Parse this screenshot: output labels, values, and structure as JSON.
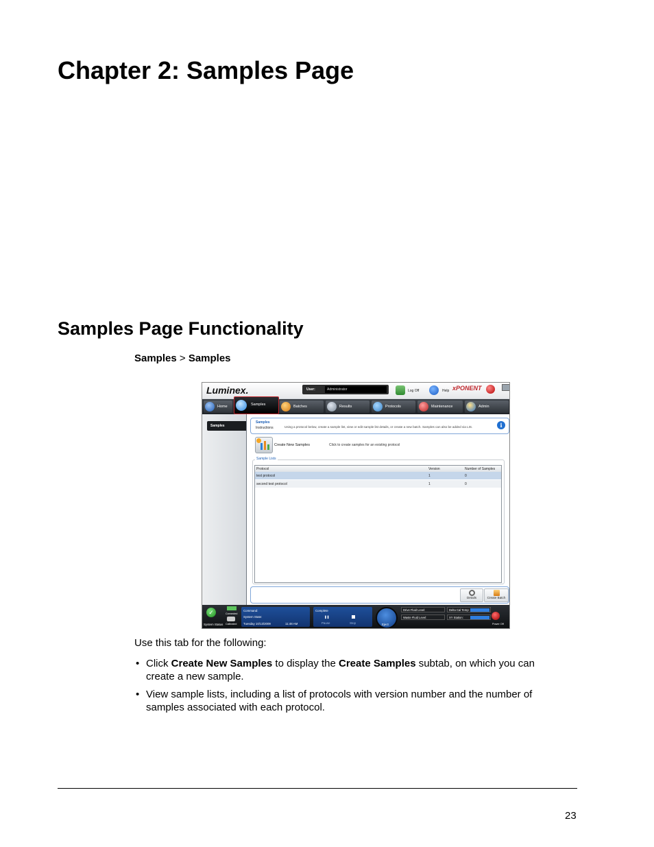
{
  "document": {
    "chapter_title": "Chapter 2: Samples Page",
    "section_title": "Samples Page Functionality",
    "breadcrumb": {
      "part1": "Samples",
      "sep": ">",
      "part2": "Samples"
    },
    "intro": "Use this tab for the following:",
    "bullets": [
      {
        "pre": "Click ",
        "b1": "Create New Samples",
        "mid": " to display the ",
        "b2": "Create Samples",
        "post": " subtab, on which you can create a new sample."
      },
      {
        "text": "View sample lists, including a list of protocols with version number and the number of samples associated with each protocol."
      }
    ],
    "bullet_char": "•",
    "page_number": "23"
  },
  "screenshot": {
    "logo": "Luminex.",
    "user_label": "User:",
    "user_value": "Administrator",
    "logoff_label": "Log Off",
    "help_label": "Help",
    "brand": "xPONENT",
    "nav": [
      "Home",
      "Samples",
      "Batches",
      "Results",
      "Protocols",
      "Maintenance",
      "Admin"
    ],
    "sidebar_item": "Samples",
    "instructions": {
      "title": "Samples",
      "subtitle": "Instructions",
      "text": "Using a protocol below, create a sample list, view or edit sample list details, or create a new batch. Samples can also be added via LIS."
    },
    "create_new_samples": "Create New Samples",
    "create_desc": "Click to create samples for an existing protocol",
    "sample_lists_title": "Sample Lists",
    "table": {
      "headers": [
        "Protocol",
        "Version",
        "Number of Samples"
      ],
      "rows": [
        [
          "test protocol",
          "1",
          "0"
        ],
        [
          "second test protocol",
          "1",
          "0"
        ]
      ]
    },
    "buttons": {
      "details": "Details",
      "create_batch": "Create Batch"
    },
    "status": {
      "system_status": "System Status",
      "connected": "Connected",
      "calibrated": "Calibrated",
      "command": "Command:",
      "system_state": "System State:",
      "datetime": "Tuesday 10/13/2009",
      "time": "11:48 AM",
      "complete": "Complete",
      "pause": "Pause",
      "stop": "Stop",
      "eject": "Eject",
      "drive_fluid": "Drive Fluid Level:",
      "waste_fluid": "Waste Fluid Level:",
      "delta_cal": "Delta Cal Temp:",
      "xy_station": "XY Station:",
      "power_off": "Power Off"
    }
  }
}
